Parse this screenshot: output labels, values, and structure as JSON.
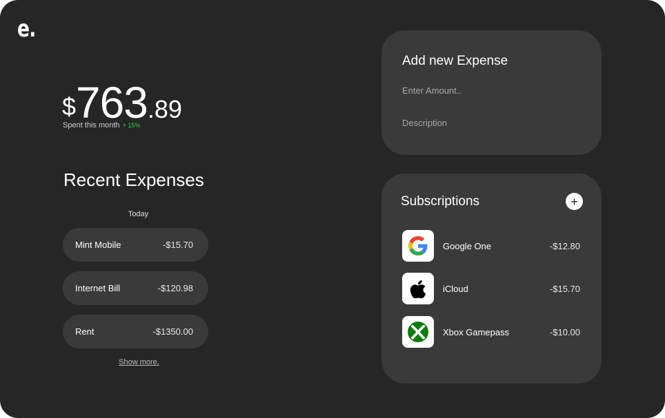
{
  "brand": {
    "logo": "e."
  },
  "summary": {
    "currency": "$",
    "amount_whole": "763",
    "amount_cents": ".89",
    "caption": "Spent this month",
    "change": "+ 15%",
    "change_color": "#2ecc4a"
  },
  "recent": {
    "title": "Recent Expenses",
    "group_label": "Today",
    "items": [
      {
        "name": "Mint Mobile",
        "amount": "-$15.70"
      },
      {
        "name": "Internet Bill",
        "amount": "-$120.98"
      },
      {
        "name": "Rent",
        "amount": "-$1350.00"
      }
    ],
    "show_more": "Show more."
  },
  "add_expense": {
    "title": "Add new Expense",
    "amount_placeholder": "Enter Amount..",
    "description_placeholder": "Description"
  },
  "subscriptions": {
    "title": "Subscriptions",
    "add_label": "+",
    "items": [
      {
        "name": "Google One",
        "price": "-$12.80",
        "icon": "google-icon"
      },
      {
        "name": "iCloud",
        "price": "-$15.70",
        "icon": "apple-icon"
      },
      {
        "name": "Xbox Gamepass",
        "price": "-$10.00",
        "icon": "xbox-icon"
      }
    ]
  },
  "colors": {
    "background": "#262626",
    "card": "#3a3a3a",
    "accent_positive": "#2ecc4a"
  }
}
